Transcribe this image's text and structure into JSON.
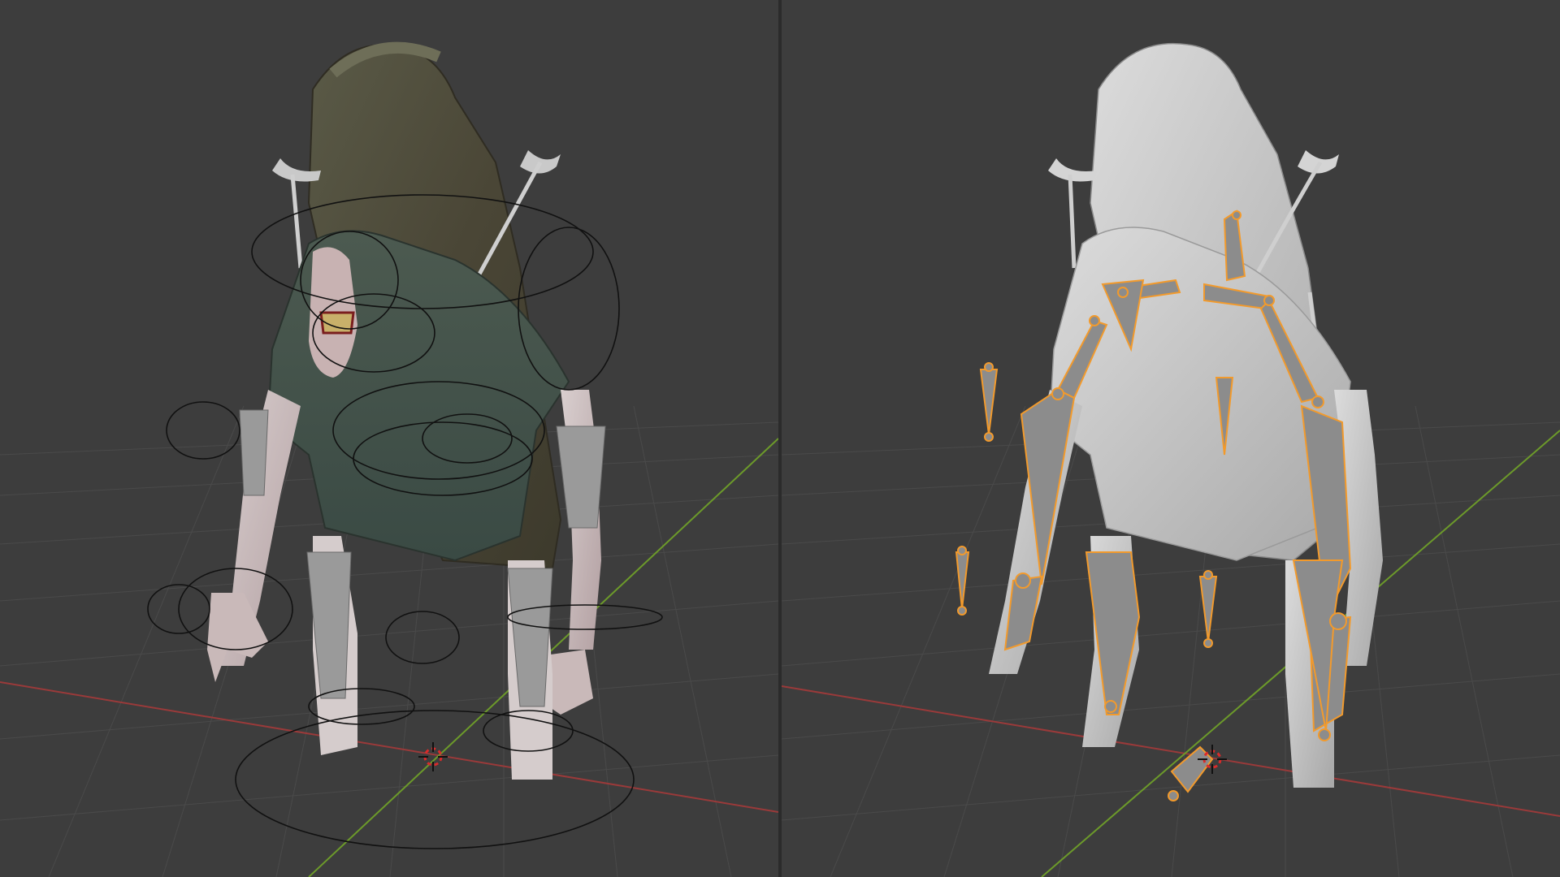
{
  "app": {
    "name": "",
    "mode": ""
  },
  "colors": {
    "background": "#3d3d3d",
    "grid": "#4a4a4a",
    "x_axis": "#9a3a3a",
    "y_axis": "#6c9a2a",
    "bone_outline": "#f29a2c",
    "bone_fill": "#8c8c8c",
    "controller": "#111111",
    "cursor_red": "#d92b2b"
  },
  "viewports": [
    {
      "id": "left",
      "shading": "material-preview",
      "icons": [
        "3d-cursor-icon"
      ]
    },
    {
      "id": "right",
      "shading": "solid",
      "icons": [
        "3d-cursor-icon"
      ]
    }
  ]
}
